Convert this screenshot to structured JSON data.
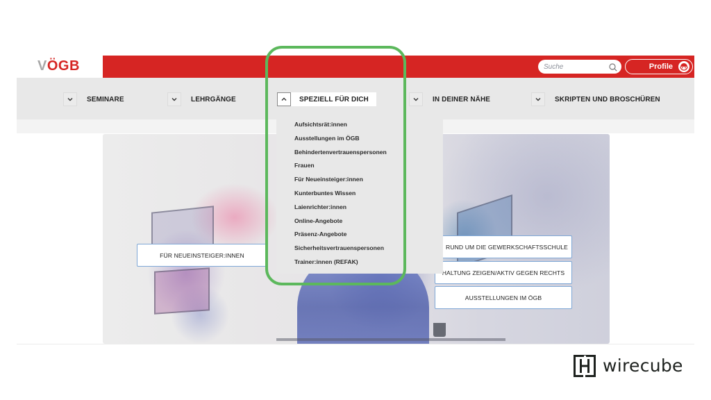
{
  "header": {
    "logo": {
      "prefix": "V",
      "rest": "ÖGB"
    },
    "search": {
      "placeholder": "Suche"
    },
    "profile": {
      "label": "Profile"
    }
  },
  "nav": {
    "items": [
      {
        "label": "SEMINARE",
        "expanded": false
      },
      {
        "label": "LEHRGÄNGE",
        "expanded": false
      },
      {
        "label": "SPEZIELL FÜR DICH",
        "expanded": true
      },
      {
        "label": "IN DEINER NÄHE",
        "expanded": false
      },
      {
        "label": "SKRIPTEN UND BROSCHÜREN",
        "expanded": false
      }
    ]
  },
  "dropdown": {
    "items": [
      "Aufsichtsrät:innen",
      "Ausstellungen im ÖGB",
      "Behindertenvertrauenspersonen",
      "Frauen",
      "Für Neueinsteiger:innen",
      "Kunterbuntes Wissen",
      "Laienrichter:innen",
      "Online-Angebote",
      "Präsenz-Angebote",
      "Sicherheitsvertrauenspersonen",
      "Trainer:innen (REFAK)"
    ]
  },
  "hero": {
    "buttons": [
      "FÜR NEUEINSTEIGER:INNEN",
      "RUND UM DIE GEWERKSCHAFTSSCHULE",
      "HALTUNG ZEIGEN/AKTIV GEGEN RECHTS",
      "AUSSTELLUNGEN IM ÖGB"
    ]
  },
  "branding": {
    "wirecube": "wirecube"
  },
  "colors": {
    "brand_red": "#d62523",
    "highlight_green": "#5cb85c",
    "nav_bg": "#e8e8e8"
  }
}
